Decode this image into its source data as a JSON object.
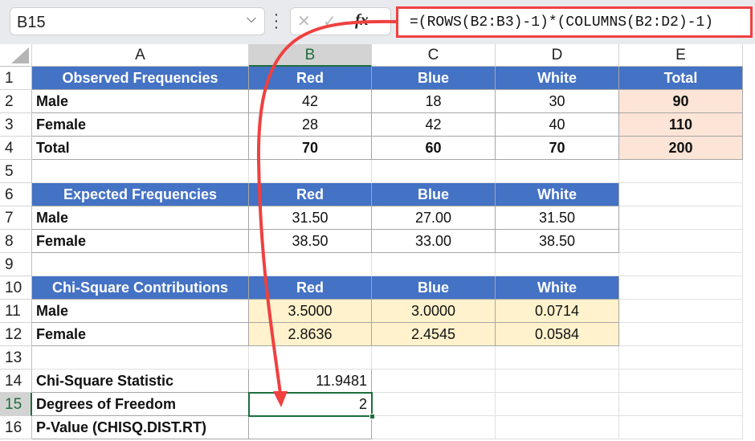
{
  "formula_bar": {
    "name_box": "B15",
    "formula": "=(ROWS(B2:B3)-1)*(COLUMNS(B2:D2)-1)",
    "cancel": "✕",
    "enter": "✓",
    "fx": "fx"
  },
  "columns": [
    "A",
    "B",
    "C",
    "D",
    "E"
  ],
  "rows": [
    "1",
    "2",
    "3",
    "4",
    "5",
    "6",
    "7",
    "8",
    "9",
    "10",
    "11",
    "12",
    "13",
    "14",
    "15",
    "16"
  ],
  "observed": {
    "title": "Observed Frequencies",
    "headers": [
      "Red",
      "Blue",
      "White",
      "Total"
    ],
    "rows": [
      {
        "label": "Male",
        "values": [
          "42",
          "18",
          "30"
        ],
        "total": "90"
      },
      {
        "label": "Female",
        "values": [
          "28",
          "42",
          "40"
        ],
        "total": "110"
      },
      {
        "label": "Total",
        "values": [
          "70",
          "60",
          "70"
        ],
        "total": "200"
      }
    ]
  },
  "expected": {
    "title": "Expected Frequencies",
    "headers": [
      "Red",
      "Blue",
      "White"
    ],
    "rows": [
      {
        "label": "Male",
        "values": [
          "31.50",
          "27.00",
          "31.50"
        ]
      },
      {
        "label": "Female",
        "values": [
          "38.50",
          "33.00",
          "38.50"
        ]
      }
    ]
  },
  "contrib": {
    "title": "Chi-Square Contributions",
    "headers": [
      "Red",
      "Blue",
      "White"
    ],
    "rows": [
      {
        "label": "Male",
        "values": [
          "3.5000",
          "3.0000",
          "0.0714"
        ]
      },
      {
        "label": "Female",
        "values": [
          "2.8636",
          "2.4545",
          "0.0584"
        ]
      }
    ]
  },
  "summary": [
    {
      "label": "Chi-Square Statistic",
      "value": "11.9481"
    },
    {
      "label": "Degrees of Freedom",
      "value": "2"
    },
    {
      "label": "P-Value (CHISQ.DIST.RT)",
      "value": ""
    }
  ],
  "colors": {
    "header": "#4472c4",
    "total": "#fce4d6",
    "contrib": "#fff2cc",
    "arrow": "#f04040"
  }
}
